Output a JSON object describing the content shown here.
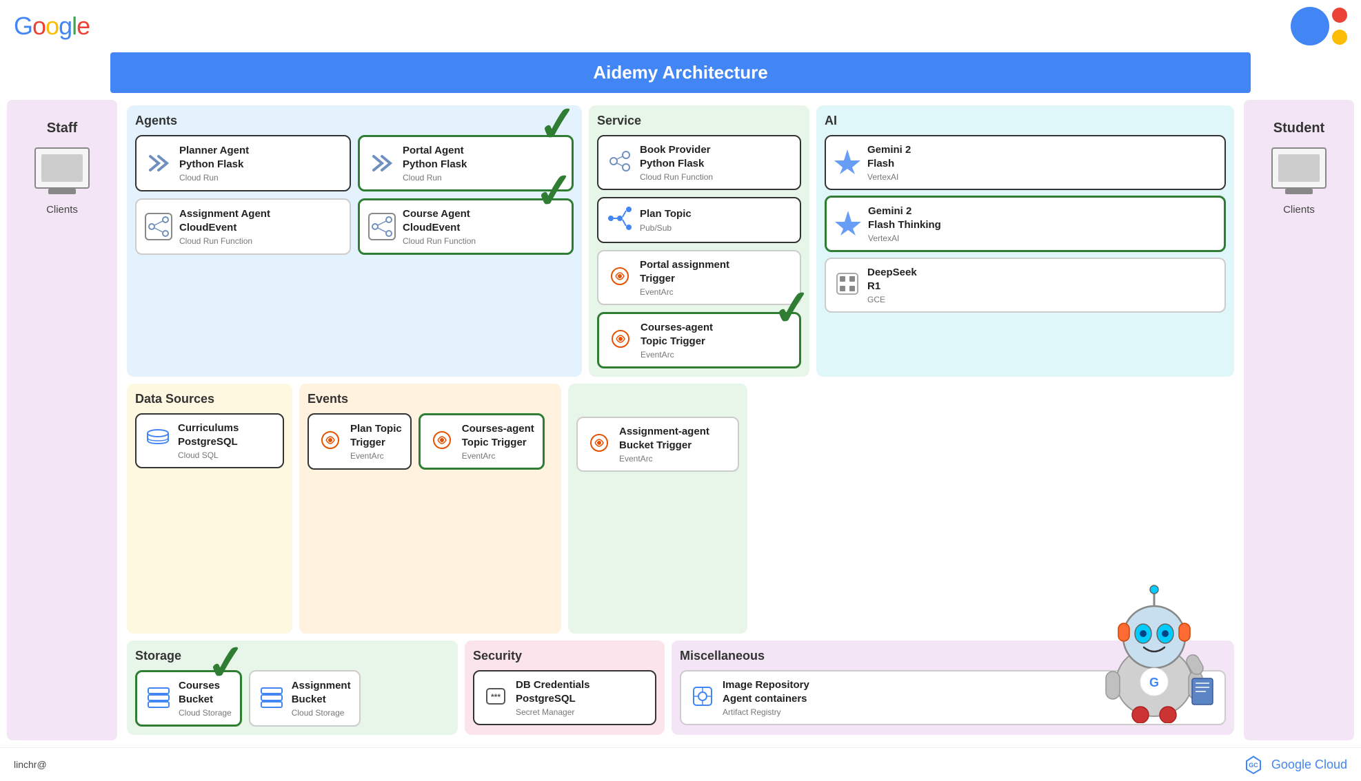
{
  "header": {
    "google_logo": "Google",
    "title": "Aidemy Architecture"
  },
  "sidebar_left": {
    "label": "Staff",
    "client_label": "Clients"
  },
  "sidebar_right": {
    "label": "Student",
    "client_label": "Clients"
  },
  "agents": {
    "section_label": "Agents",
    "cards": [
      {
        "title": "Planner Agent\nPython Flask",
        "subtitle": "Cloud Run",
        "highlighted": false,
        "dark_border": true
      },
      {
        "title": "Portal Agent\nPython Flask",
        "subtitle": "Cloud Run",
        "highlighted": true,
        "dark_border": false
      },
      {
        "title": "Assignment Agent\nCloudEvent",
        "subtitle": "Cloud Run Function",
        "highlighted": false,
        "dark_border": false
      },
      {
        "title": "Course Agent\nCloudEvent",
        "subtitle": "Cloud Run Function",
        "highlighted": true,
        "dark_border": false
      }
    ]
  },
  "service": {
    "section_label": "Service",
    "cards": [
      {
        "title": "Book Provider\nPython Flask",
        "subtitle": "Cloud Run Function",
        "highlighted": false,
        "dark_border": true
      },
      {
        "title": "Plan Topic",
        "subtitle": "Pub/Sub",
        "highlighted": false,
        "dark_border": true
      },
      {
        "title": "Portal assignment\nTrigger",
        "subtitle": "EventArc",
        "highlighted": false,
        "dark_border": false
      },
      {
        "title": "Courses-agent\nTopic Trigger",
        "subtitle": "EventArc",
        "highlighted": true,
        "dark_border": false
      }
    ]
  },
  "ai": {
    "section_label": "AI",
    "cards": [
      {
        "title": "Gemini 2\nFlash",
        "subtitle": "VertexAI",
        "highlighted": false,
        "dark_border": true
      },
      {
        "title": "Gemini 2\nFlash Thinking",
        "subtitle": "VertexAI",
        "highlighted": true,
        "dark_border": false
      },
      {
        "title": "DeepSeek\nR1",
        "subtitle": "GCE",
        "highlighted": false,
        "dark_border": false
      }
    ]
  },
  "data_sources": {
    "section_label": "Data Sources",
    "cards": [
      {
        "title": "Curriculums\nPostgreSQL",
        "subtitle": "Cloud SQL",
        "dark_border": true
      }
    ]
  },
  "events": {
    "section_label": "Events",
    "cards": [
      {
        "title": "Plan Topic\nTrigger",
        "subtitle": "EventArc",
        "dark_border": true
      },
      {
        "title": "Courses-agent\nTopic Trigger",
        "subtitle": "EventArc",
        "highlighted": true,
        "dark_border": false
      }
    ]
  },
  "assignment_agent": {
    "cards": [
      {
        "title": "Assignment-agent\nBucket Trigger",
        "subtitle": "EventArc",
        "dark_border": false
      }
    ]
  },
  "storage": {
    "section_label": "Storage",
    "cards": [
      {
        "title": "Courses\nBucket",
        "subtitle": "Cloud Storage",
        "highlighted": true,
        "dark_border": false
      },
      {
        "title": "Assignment\nBucket",
        "subtitle": "Cloud Storage",
        "highlighted": false,
        "dark_border": false
      }
    ]
  },
  "security": {
    "section_label": "Security",
    "cards": [
      {
        "title": "DB Credentials\nPostgreSQL",
        "subtitle": "Secret Manager",
        "dark_border": true
      }
    ]
  },
  "miscellaneous": {
    "section_label": "Miscellaneous",
    "cards": [
      {
        "title": "Image Repository\nAgent containers",
        "subtitle": "Artifact Registry",
        "dark_border": false
      }
    ]
  },
  "bottom_bar": {
    "user": "linchr@",
    "google_cloud": "Google Cloud"
  }
}
